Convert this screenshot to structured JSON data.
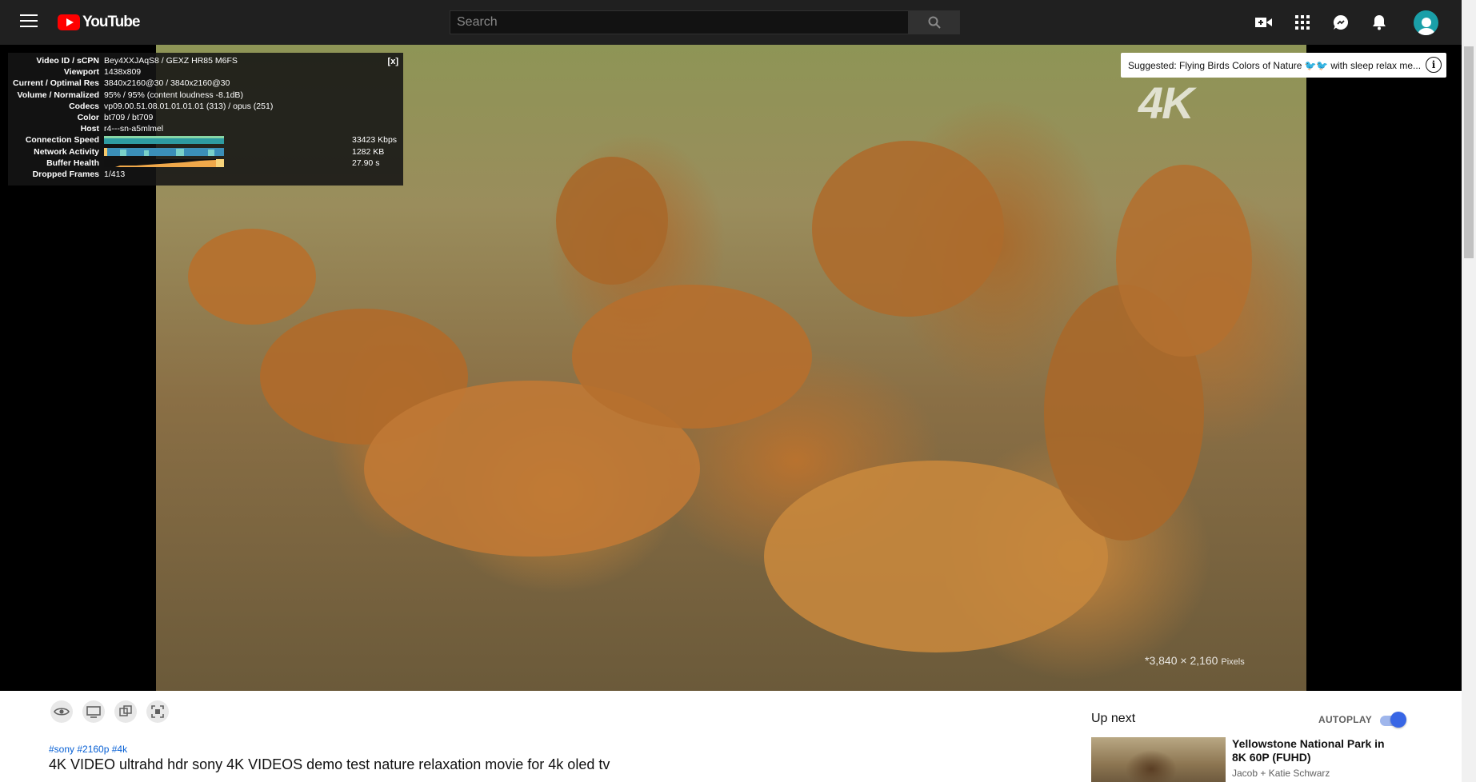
{
  "header": {
    "logo_text": "YouTube",
    "search_placeholder": "Search",
    "icons": [
      "menu-icon",
      "create-video-icon",
      "apps-icon",
      "messages-icon",
      "notifications-icon"
    ]
  },
  "player": {
    "suggested_prefix": "Suggested: Flying Birds Colors of Nature ",
    "suggested_suffix": "with sleep relax me...",
    "suggested_info": "i",
    "watermark": "4K",
    "pixels_text": "*3,840 × 2,160",
    "pixels_unit": "Pixels",
    "stats": {
      "close": "[x]",
      "rows": [
        {
          "k": "Video ID / sCPN",
          "v": "Bey4XXJAqS8 / GEXZ HR85 M6FS"
        },
        {
          "k": "Viewport",
          "v": "1438x809"
        },
        {
          "k": "Current / Optimal Res",
          "v": "3840x2160@30 / 3840x2160@30"
        },
        {
          "k": "Volume / Normalized",
          "v": "95% / 95% (content loudness -8.1dB)"
        },
        {
          "k": "Codecs",
          "v": "vp09.00.51.08.01.01.01.01 (313) / opus (251)"
        },
        {
          "k": "Color",
          "v": "bt709 / bt709"
        },
        {
          "k": "Host",
          "v": "r4---sn-a5mlmel"
        }
      ],
      "connection_speed_label": "Connection Speed",
      "connection_speed": "33423 Kbps",
      "network_activity_label": "Network Activity",
      "network_activity": "1282 KB",
      "buffer_health_label": "Buffer Health",
      "buffer_health": "27.90 s",
      "dropped_frames_label": "Dropped Frames",
      "dropped_frames": "1/413"
    }
  },
  "below": {
    "hashtags": "#sony #2160p #4k",
    "title": "4K VIDEO ultrahd hdr sony 4K VIDEOS demo test nature relaxation movie for 4k oled tv",
    "up_next": "Up next",
    "autoplay": "AUTOPLAY",
    "autoplay_on": true,
    "recommendation": {
      "title": "Yellowstone National Park in 8K 60P (FUHD)",
      "channel": "Jacob + Katie Schwarz"
    }
  },
  "colors": {
    "topbar": "#202020",
    "brand_red": "#ff0000",
    "link_blue": "#065fd4",
    "toggle_blue": "#3866e5"
  }
}
